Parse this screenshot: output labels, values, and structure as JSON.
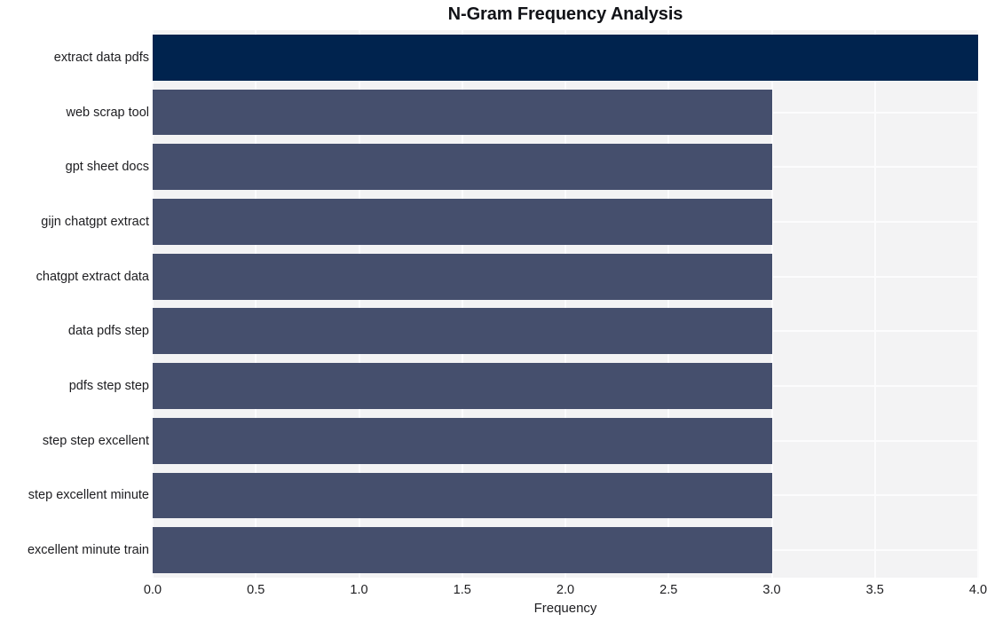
{
  "chart_data": {
    "type": "bar",
    "orientation": "horizontal",
    "title": "N-Gram Frequency Analysis",
    "xlabel": "Frequency",
    "ylabel": "",
    "xlim": [
      0.0,
      4.0
    ],
    "xticks": [
      "0.0",
      "0.5",
      "1.0",
      "1.5",
      "2.0",
      "2.5",
      "3.0",
      "3.5",
      "4.0"
    ],
    "xtick_values": [
      0.0,
      0.5,
      1.0,
      1.5,
      2.0,
      2.5,
      3.0,
      3.5,
      4.0
    ],
    "grid": true,
    "legend": null,
    "categories": [
      "extract data pdfs",
      "web scrap tool",
      "gpt sheet docs",
      "gijn chatgpt extract",
      "chatgpt extract data",
      "data pdfs step",
      "pdfs step step",
      "step step excellent",
      "step excellent minute",
      "excellent minute train"
    ],
    "values": [
      4,
      3,
      3,
      3,
      3,
      3,
      3,
      3,
      3,
      3
    ],
    "colors": {
      "bar_default": "#454f6d",
      "bar_highlight": "#00234e",
      "plot_background": "#f3f3f4",
      "grid": "#fcfcfd",
      "figure_background": "#ffffff",
      "text": "#1d1d20",
      "title_text": "#111217"
    },
    "highlight_index": 0
  }
}
